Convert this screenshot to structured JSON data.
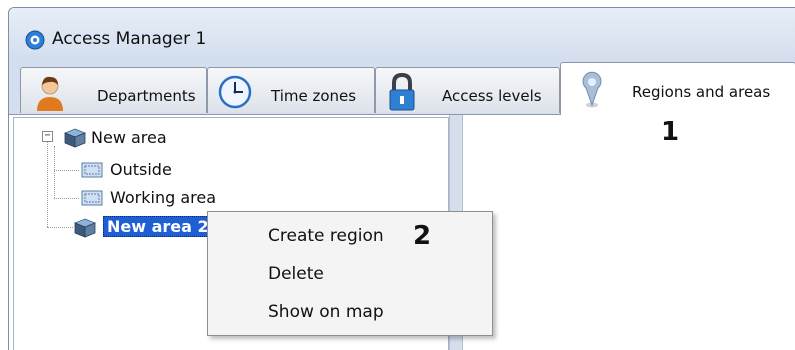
{
  "window": {
    "title": "Access Manager 1"
  },
  "tabs": [
    {
      "label": "Departments",
      "icon": "person-icon",
      "active": false
    },
    {
      "label": "Time zones",
      "icon": "clock-icon",
      "active": false
    },
    {
      "label": "Access levels",
      "icon": "padlock-icon",
      "active": false
    },
    {
      "label": "Regions and areas",
      "icon": "map-pin-icon",
      "active": true
    }
  ],
  "tree": {
    "items": [
      {
        "label": "New area",
        "icon": "area-cube-icon",
        "expanded": true
      },
      {
        "label": "Outside",
        "icon": "region-icon"
      },
      {
        "label": "Working area",
        "icon": "region-icon"
      },
      {
        "label": "New area 2",
        "icon": "area-cube-icon",
        "selected": true
      }
    ]
  },
  "context_menu": {
    "items": [
      {
        "label": "Create region"
      },
      {
        "label": "Delete"
      },
      {
        "label": "Show on map"
      }
    ]
  },
  "callouts": {
    "one": "1",
    "two": "2"
  },
  "colors": {
    "selection": "#1e5fd6",
    "window_frame": "#d3dfee"
  }
}
